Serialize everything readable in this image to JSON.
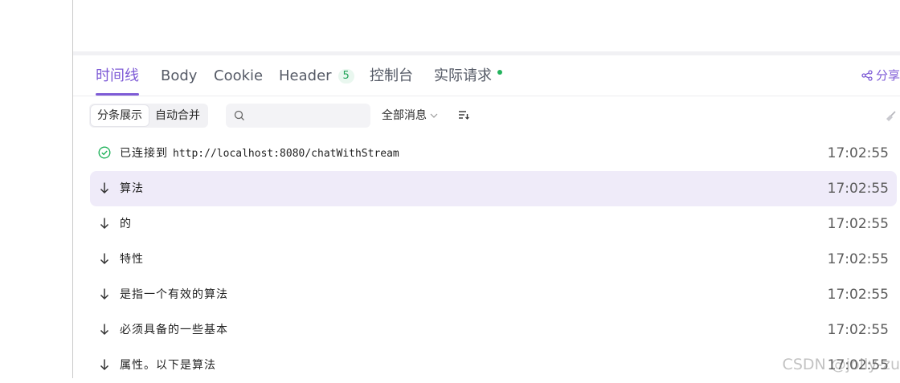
{
  "tabs": [
    {
      "label": "时间线",
      "active": true
    },
    {
      "label": "Body"
    },
    {
      "label": "Cookie"
    },
    {
      "label": "Header",
      "badge": "5"
    },
    {
      "label": "控制台"
    },
    {
      "label": "实际请求",
      "status_dot": "#23b35d"
    }
  ],
  "share_label": "分享",
  "toolbar": {
    "view_modes": [
      "分条展示",
      "自动合并"
    ],
    "active_view_mode": "分条展示",
    "search_placeholder": "",
    "filter_label": "全部消息"
  },
  "messages": [
    {
      "icon": "check-circle-icon",
      "text": "已连接到",
      "url": "http://localhost:8080/chatWithStream",
      "time": "17:02:55"
    },
    {
      "icon": "arrow-down-icon",
      "text": "算法",
      "time": "17:02:55",
      "highlighted": true
    },
    {
      "icon": "arrow-down-icon",
      "text": "的",
      "time": "17:02:55"
    },
    {
      "icon": "arrow-down-icon",
      "text": "特性",
      "time": "17:02:55"
    },
    {
      "icon": "arrow-down-icon",
      "text": "是指一个有效的算法",
      "time": "17:02:55"
    },
    {
      "icon": "arrow-down-icon",
      "text": "必须具备的一些基本",
      "time": "17:02:55"
    },
    {
      "icon": "arrow-down-icon",
      "text": "属性。以下是算法",
      "time": "17:02:55"
    }
  ],
  "watermark": "CSDN @jolly-zu",
  "colors": {
    "accent": "#7e5bd6",
    "success": "#23b35d",
    "highlight_row": "#efebf9"
  }
}
